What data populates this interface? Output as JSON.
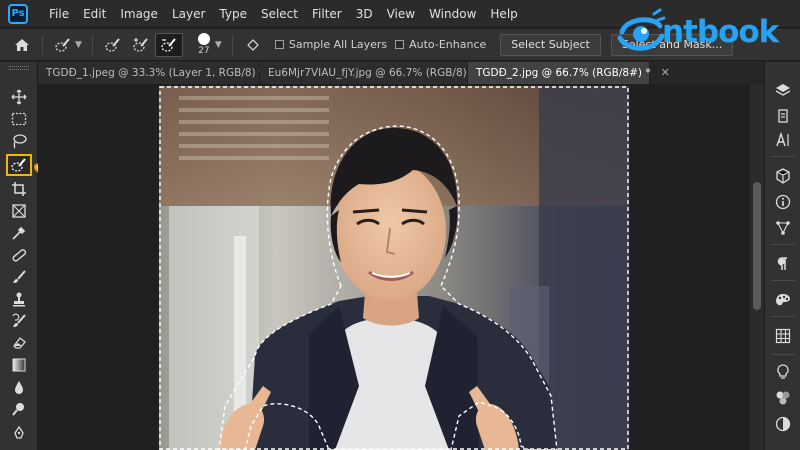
{
  "app": {
    "logo_text": "Ps"
  },
  "menu": [
    "File",
    "Edit",
    "Image",
    "Layer",
    "Type",
    "Select",
    "Filter",
    "3D",
    "View",
    "Window",
    "Help"
  ],
  "brand": {
    "name": "ntbook",
    "color": "#27a3f3"
  },
  "options": {
    "brush_size": "27",
    "sample_all_layers": "Sample All Layers",
    "auto_enhance": "Auto-Enhance",
    "select_subject": "Select Subject",
    "select_and_mask": "Select and Mask..."
  },
  "tabs": [
    {
      "label": "TGDĐ_1.jpeg @ 33.3% (Layer 1, RGB/8) *",
      "active": false
    },
    {
      "label": "Eu6Mjr7VIAU_fjY.jpg @ 66.7% (RGB/8)",
      "active": false
    },
    {
      "label": "TGDĐ_2.jpg @ 66.7% (RGB/8#) *",
      "active": true
    }
  ],
  "colors": {
    "accent": "#31a8ff",
    "highlight": "#f5b800",
    "ps_bg": "#001e36"
  },
  "left_tools": [
    "move-icon",
    "marquee-icon",
    "lasso-icon",
    "quick-selection-icon",
    "crop-icon",
    "frame-icon",
    "eyedropper-icon",
    "healing-brush-icon",
    "brush-icon",
    "clone-stamp-icon",
    "history-brush-icon",
    "eraser-icon",
    "gradient-icon",
    "blur-icon",
    "dodge-icon",
    "pen-icon"
  ],
  "right_tools": [
    "layers-icon",
    "paths-icon",
    "character-icon",
    "3d-icon",
    "info-icon",
    "properties-icon",
    "paragraph-icon",
    "color-icon",
    "swatches-icon",
    "learn-icon",
    "styles-icon",
    "adjustments-icon"
  ]
}
